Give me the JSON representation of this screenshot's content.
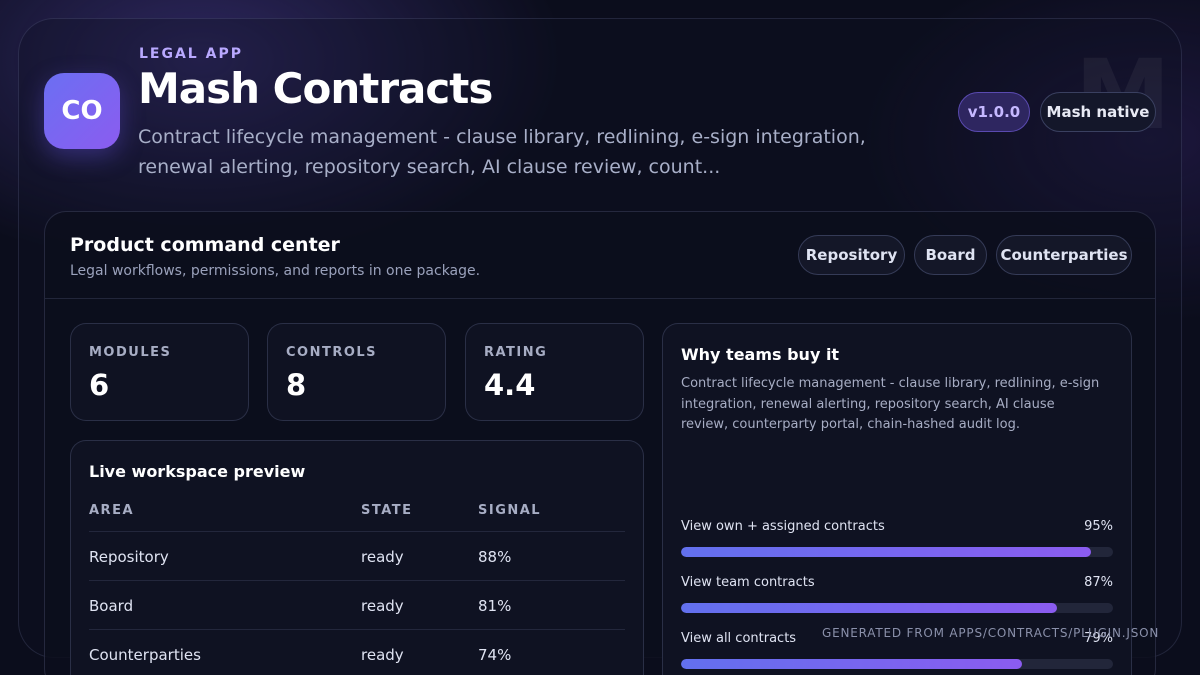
{
  "header": {
    "watermark": "M",
    "app_icon_text": "CO",
    "eyebrow": "LEGAL APP",
    "title": "Mash Contracts",
    "subtitle": "Contract lifecycle management - clause library, redlining, e-sign integration, renewal alerting, repository search, AI clause review, count...",
    "version_badge": "v1.0.0",
    "native_badge": "Mash native"
  },
  "panel": {
    "title": "Product command center",
    "subtitle": "Legal workflows, permissions, and reports in one package.",
    "tabs": [
      "Repository",
      "Board",
      "Counterparties"
    ]
  },
  "stats": [
    {
      "label": "MODULES",
      "value": "6"
    },
    {
      "label": "CONTROLS",
      "value": "8"
    },
    {
      "label": "RATING",
      "value": "4.4"
    }
  ],
  "preview": {
    "title": "Live workspace preview",
    "columns": [
      "AREA",
      "STATE",
      "SIGNAL"
    ],
    "rows": [
      {
        "area": "Repository",
        "state": "ready",
        "signal": "88%"
      },
      {
        "area": "Board",
        "state": "ready",
        "signal": "81%"
      },
      {
        "area": "Counterparties",
        "state": "ready",
        "signal": "74%"
      }
    ]
  },
  "why": {
    "title": "Why teams buy it",
    "text": "Contract lifecycle management - clause library, redlining, e-sign integration, renewal alerting, repository search, AI clause review, counterparty portal, chain-hashed audit log.",
    "permissions": [
      {
        "label": "View own + assigned contracts",
        "pct_label": "95%",
        "value": 0.95
      },
      {
        "label": "View team contracts",
        "pct_label": "87%",
        "value": 0.87
      },
      {
        "label": "View all contracts",
        "pct_label": "79%",
        "value": 0.79
      }
    ]
  },
  "footer_note": "GENERATED FROM APPS/CONTRACTS/PLUGIN.JSON",
  "colors": {
    "accent": "#8b5cf0",
    "accent_start": "#6270ee",
    "background": "#0b0d1c"
  }
}
